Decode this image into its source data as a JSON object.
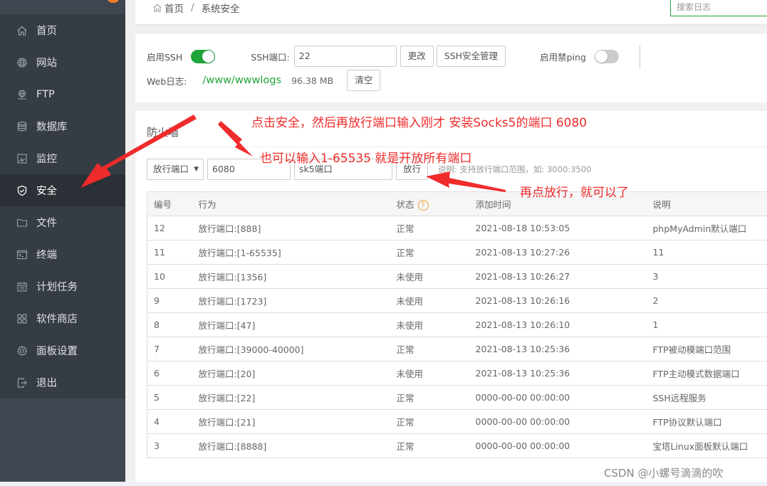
{
  "sidebar": {
    "items": [
      {
        "label": "首页",
        "icon": "home-icon"
      },
      {
        "label": "网站",
        "icon": "globe-icon"
      },
      {
        "label": "FTP",
        "icon": "ftp-icon"
      },
      {
        "label": "数据库",
        "icon": "database-icon"
      },
      {
        "label": "监控",
        "icon": "monitor-icon"
      },
      {
        "label": "安全",
        "icon": "shield-icon",
        "active": true
      },
      {
        "label": "文件",
        "icon": "folder-icon"
      },
      {
        "label": "终端",
        "icon": "terminal-icon"
      },
      {
        "label": "计划任务",
        "icon": "calendar-icon"
      },
      {
        "label": "软件商店",
        "icon": "apps-icon"
      },
      {
        "label": "面板设置",
        "icon": "gear-icon"
      },
      {
        "label": "退出",
        "icon": "logout-icon"
      }
    ]
  },
  "breadcrumb": {
    "home": "首页",
    "separator": "/",
    "current": "系统安全"
  },
  "search_log": {
    "placeholder": "搜索日志"
  },
  "ssh": {
    "enable_label": "启用SSH",
    "enabled": true,
    "port_label": "SSH端口:",
    "port_value": "22",
    "change_button": "更改",
    "manage_button": "SSH安全管理",
    "ping_label": "启用禁ping",
    "ping_enabled": false
  },
  "weblog": {
    "label": "Web日志:",
    "path": "/www/wwwlogs",
    "size": "96.38 MB",
    "clear_button": "清空"
  },
  "firewall": {
    "title": "防火墙",
    "select_value": "放行端口",
    "port_value": "6080",
    "note_value": "sk5端口",
    "submit_button": "放行",
    "help": "说明: 支持放行端口范围，如: 3000:3500",
    "columns": [
      "编号",
      "行为",
      "状态",
      "添加时间",
      "说明"
    ],
    "status_help_icon": "?",
    "rows": [
      {
        "id": "12",
        "action": "放行端口:[888]",
        "status": "正常",
        "time": "2021-08-18 10:53:05",
        "note": "phpMyAdmin默认端口"
      },
      {
        "id": "11",
        "action": "放行端口:[1-65535]",
        "status": "正常",
        "time": "2021-08-13 10:27:26",
        "note": "11"
      },
      {
        "id": "10",
        "action": "放行端口:[1356]",
        "status": "未使用",
        "time": "2021-08-13 10:26:27",
        "note": "3"
      },
      {
        "id": "9",
        "action": "放行端口:[1723]",
        "status": "未使用",
        "time": "2021-08-13 10:26:16",
        "note": "2"
      },
      {
        "id": "8",
        "action": "放行端口:[47]",
        "status": "未使用",
        "time": "2021-08-13 10:26:10",
        "note": "1"
      },
      {
        "id": "7",
        "action": "放行端口:[39000-40000]",
        "status": "正常",
        "time": "2021-08-13 10:25:36",
        "note": "FTP被动模端口范围"
      },
      {
        "id": "6",
        "action": "放行端口:[20]",
        "status": "未使用",
        "time": "2021-08-13 10:25:36",
        "note": "FTP主动模式数据端口"
      },
      {
        "id": "5",
        "action": "放行端口:[22]",
        "status": "正常",
        "time": "0000-00-00 00:00:00",
        "note": "SSH远程服务"
      },
      {
        "id": "4",
        "action": "放行端口:[21]",
        "status": "正常",
        "time": "0000-00-00 00:00:00",
        "note": "FTP协议默认端口"
      },
      {
        "id": "3",
        "action": "放行端口:[8888]",
        "status": "正常",
        "time": "0000-00-00 00:00:00",
        "note": "宝塔Linux面板默认端口"
      }
    ]
  },
  "annotations": {
    "a1": "点击安全，然后再放行端口输入刚才 安装Socks5的端口 6080",
    "a2": "也可以输入1-65535 就是开放所有端口",
    "a3": "再点放行，就可以了",
    "color": "#f02b2b"
  },
  "watermark": "CSDN @小螺号滴滴的吹"
}
